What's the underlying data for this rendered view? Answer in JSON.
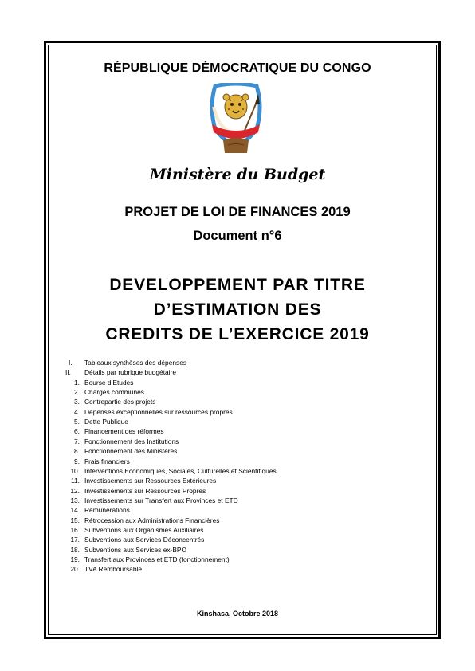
{
  "header": {
    "republic": "RÉPUBLIQUE DÉMOCRATIQUE DU CONGO",
    "emblem": {
      "icon": "coat-of-arms-icon",
      "motto_left": "JUSTICE",
      "motto_center": "PAIX",
      "motto_right": "TRAVAIL",
      "colors": {
        "blue": "#3d8fd1",
        "red": "#d8262c",
        "gold": "#e2b33c",
        "brown": "#8a5a2b"
      }
    },
    "ministry": "Ministère du Budget"
  },
  "project": {
    "title": "PROJET DE LOI DE FINANCES 2019",
    "document_number": "Document n°6"
  },
  "main_title": {
    "line1": "DEVELOPPEMENT PAR TITRE",
    "line2": "D’ESTIMATION DES",
    "line3": "CREDITS DE L’EXERCICE 2019"
  },
  "toc": [
    {
      "num": "I.",
      "label": "Tableaux synthèses des dépenses"
    },
    {
      "num": "II.",
      "label": "Détails par rubrique budgétaire"
    },
    {
      "num": "1.",
      "label": "Bourse d’Etudes"
    },
    {
      "num": "2.",
      "label": "Charges communes"
    },
    {
      "num": "3.",
      "label": "Contrepartie des projets"
    },
    {
      "num": "4.",
      "label": "Dépenses exceptionnelles sur ressources propres"
    },
    {
      "num": "5.",
      "label": "Dette Publique"
    },
    {
      "num": "6.",
      "label": "Financement des réformes"
    },
    {
      "num": "7.",
      "label": "Fonctionnement des Institutions"
    },
    {
      "num": "8.",
      "label": "Fonctionnement des Ministères"
    },
    {
      "num": "9.",
      "label": "Frais financiers"
    },
    {
      "num": "10.",
      "label": "Interventions Economiques, Sociales, Culturelles et Scientifiques"
    },
    {
      "num": "11.",
      "label": "Investissements sur Ressources Extérieures"
    },
    {
      "num": "12.",
      "label": "Investissements sur Ressources Propres"
    },
    {
      "num": "13.",
      "label": "Investissements sur Transfert aux Provinces et ETD"
    },
    {
      "num": "14.",
      "label": "Rémunérations"
    },
    {
      "num": "15.",
      "label": "Rétrocession aux Administrations Financières"
    },
    {
      "num": "16.",
      "label": "Subventions aux Organismes Auxiliaires"
    },
    {
      "num": "17.",
      "label": "Subventions aux Services Déconcentrés"
    },
    {
      "num": "18.",
      "label": "Subventions aux Services ex-BPO"
    },
    {
      "num": "19.",
      "label": "Transfert aux Provinces et ETD (fonctionnement)"
    },
    {
      "num": "20.",
      "label": "TVA Remboursable"
    }
  ],
  "footer": "Kinshasa, Octobre 2018"
}
